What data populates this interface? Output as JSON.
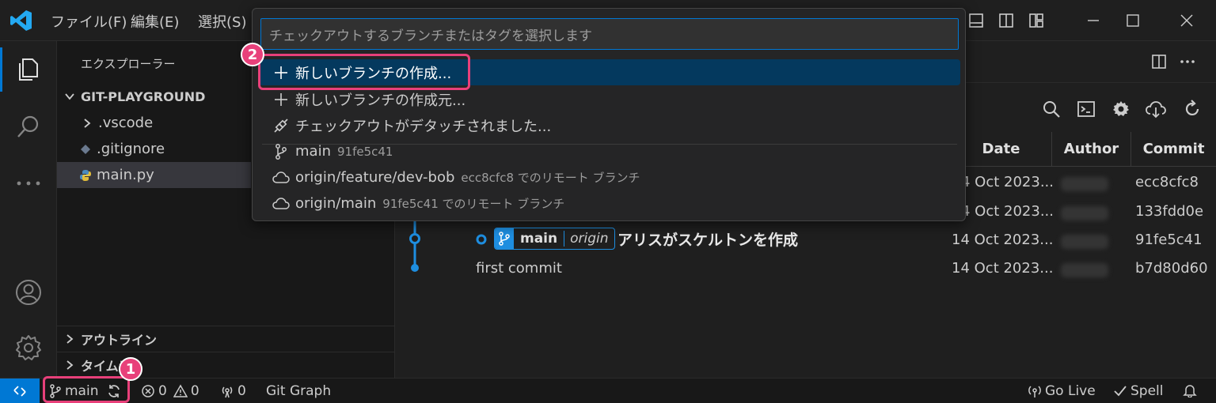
{
  "menu": [
    "ファイル(F)",
    "編集(E)",
    "選択(S)"
  ],
  "sidebar": {
    "title": "エクスプローラー",
    "folder": "GIT-PLAYGROUND",
    "items": [
      {
        "label": ".vscode"
      },
      {
        "label": ".gitignore"
      },
      {
        "label": "main.py"
      }
    ],
    "outline": "アウトライン",
    "timeline": "タイムラ"
  },
  "quickpick": {
    "placeholder": "チェックアウトするブランチまたはタグを選択します",
    "items": [
      {
        "label": "新しいブランチの作成..."
      },
      {
        "label": "新しいブランチの作成元..."
      },
      {
        "label": "チェックアウトがデタッチされました..."
      },
      {
        "label": "main",
        "desc": "91fe5c41"
      },
      {
        "label": "origin/feature/dev-bob",
        "desc": "ecc8cfc8 でのリモート ブランチ"
      },
      {
        "label": "origin/main",
        "desc": "91fe5c41 でのリモート ブランチ"
      }
    ]
  },
  "git_graph": {
    "headers": {
      "date": "Date",
      "author": "Author",
      "commit": "Commit"
    },
    "rows": [
      {
        "date": "4 Oct 2023...",
        "commit": "ecc8cfc8"
      },
      {
        "date": "4 Oct 2023...",
        "commit": "133fdd0e"
      },
      {
        "description": "アリスがスケルトンを作成",
        "branch": "main",
        "remote": "origin",
        "date": "14 Oct 2023...",
        "commit": "91fe5c41"
      },
      {
        "description": "first commit",
        "date": "14 Oct 2023...",
        "commit": "b7d80d60"
      }
    ]
  },
  "statusbar": {
    "branch": "main",
    "errors": "0",
    "warnings": "0",
    "ports": "0",
    "git_graph": "Git Graph",
    "go_live": "Go Live",
    "spell": "Spell"
  },
  "callouts": [
    "1",
    "2"
  ],
  "colors": {
    "accent": "#0078d4",
    "callout": "#e8407a",
    "focus": "#04395e"
  }
}
